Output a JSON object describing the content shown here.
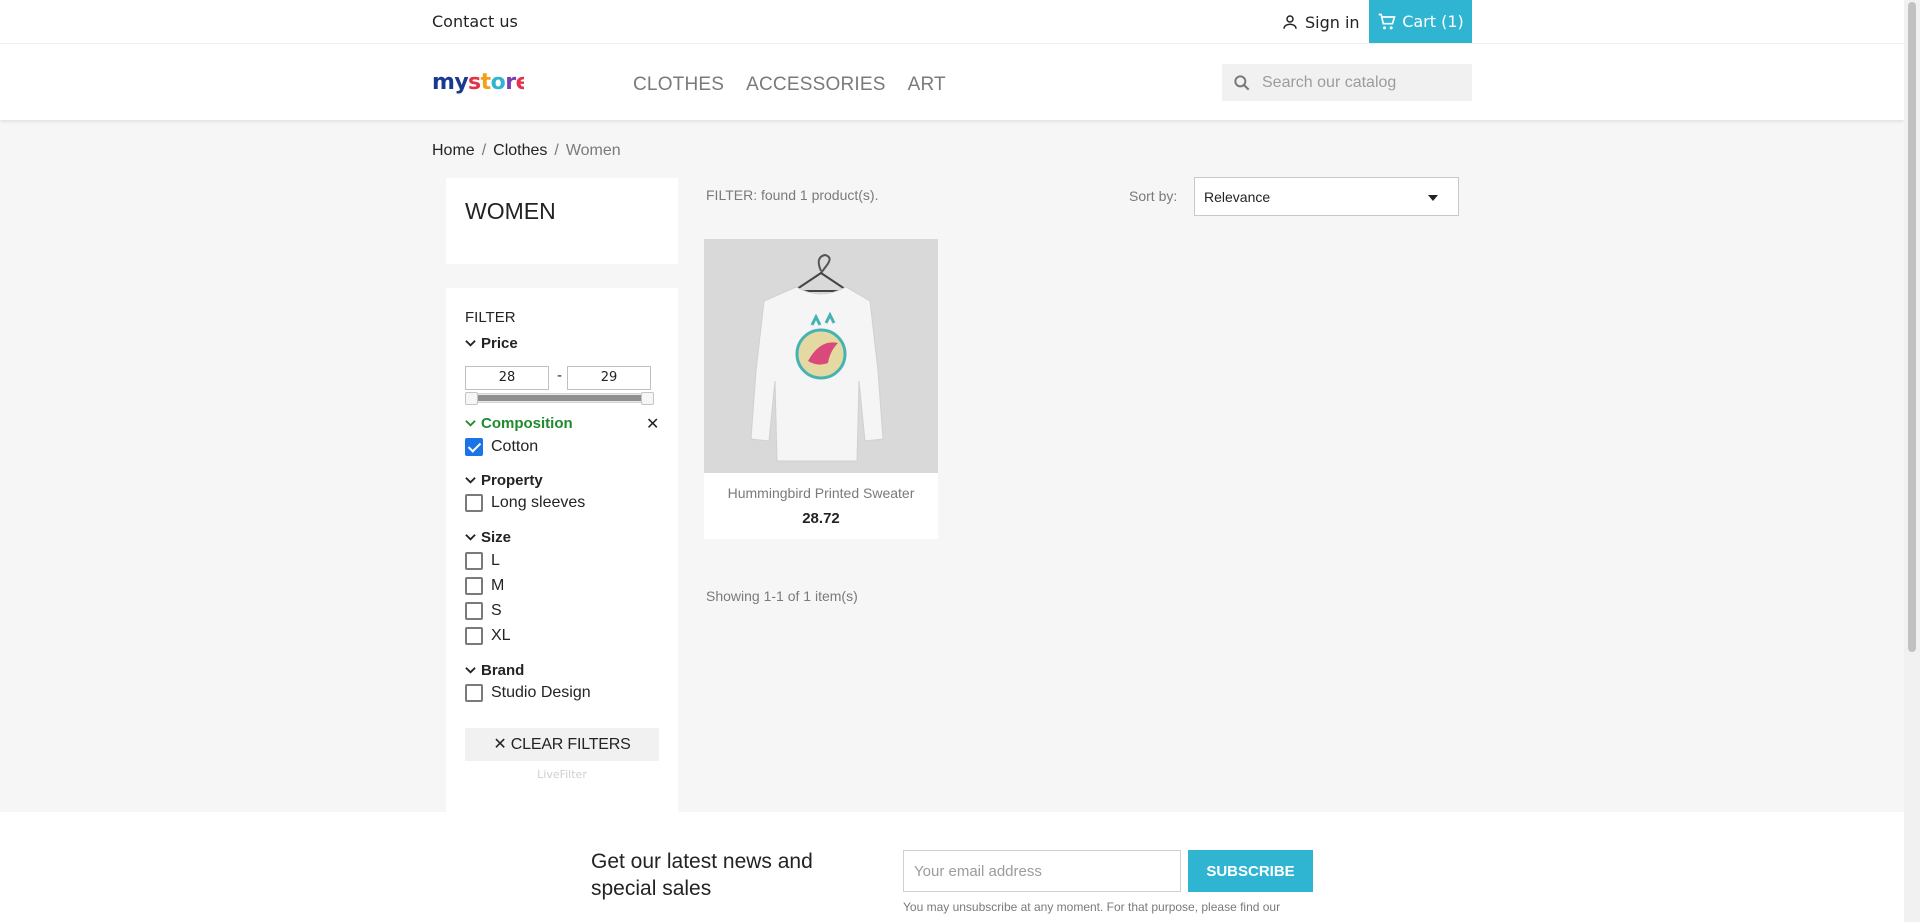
{
  "top_nav": {
    "contact": "Contact us",
    "sign_in": "Sign in",
    "cart": "Cart (1)"
  },
  "header": {
    "logo": "my store",
    "menu": [
      "CLOTHES",
      "ACCESSORIES",
      "ART"
    ],
    "search_placeholder": "Search our catalog"
  },
  "breadcrumb": {
    "items": [
      "Home",
      "Clothes",
      "Women"
    ],
    "separator": "/"
  },
  "category": {
    "title": "WOMEN"
  },
  "filters": {
    "heading": "FILTER",
    "price": {
      "label": "Price",
      "min": "28",
      "max": "29",
      "dash": "-"
    },
    "composition": {
      "label": "Composition",
      "options": [
        {
          "label": "Cotton",
          "checked": true
        }
      ]
    },
    "property": {
      "label": "Property",
      "options": [
        {
          "label": "Long sleeves",
          "checked": false
        }
      ]
    },
    "size": {
      "label": "Size",
      "options": [
        {
          "label": "L",
          "checked": false
        },
        {
          "label": "M",
          "checked": false
        },
        {
          "label": "S",
          "checked": false
        },
        {
          "label": "XL",
          "checked": false
        }
      ]
    },
    "brand": {
      "label": "Brand",
      "options": [
        {
          "label": "Studio Design",
          "checked": false
        }
      ]
    },
    "clear_filters": "✕ CLEAR FILTERS",
    "powered_by": "LiveFilter"
  },
  "listing": {
    "filter_count": "FILTER: found 1 product(s).",
    "sort_label": "Sort by:",
    "sort_value": "Relevance",
    "products": [
      {
        "name": "Hummingbird Printed Sweater",
        "price": "28.72"
      }
    ],
    "pagination": "Showing 1-1 of 1 item(s)"
  },
  "newsletter": {
    "title": "Get our latest news and special sales",
    "email_placeholder": "Your email address",
    "subscribe": "SUBSCRIBE",
    "note": "You may unsubscribe at any moment. For that purpose, please find our"
  },
  "colors": {
    "accent": "#2fb5d2",
    "active_facet": "#1f8a2e",
    "checkbox": "#1a73e8"
  }
}
